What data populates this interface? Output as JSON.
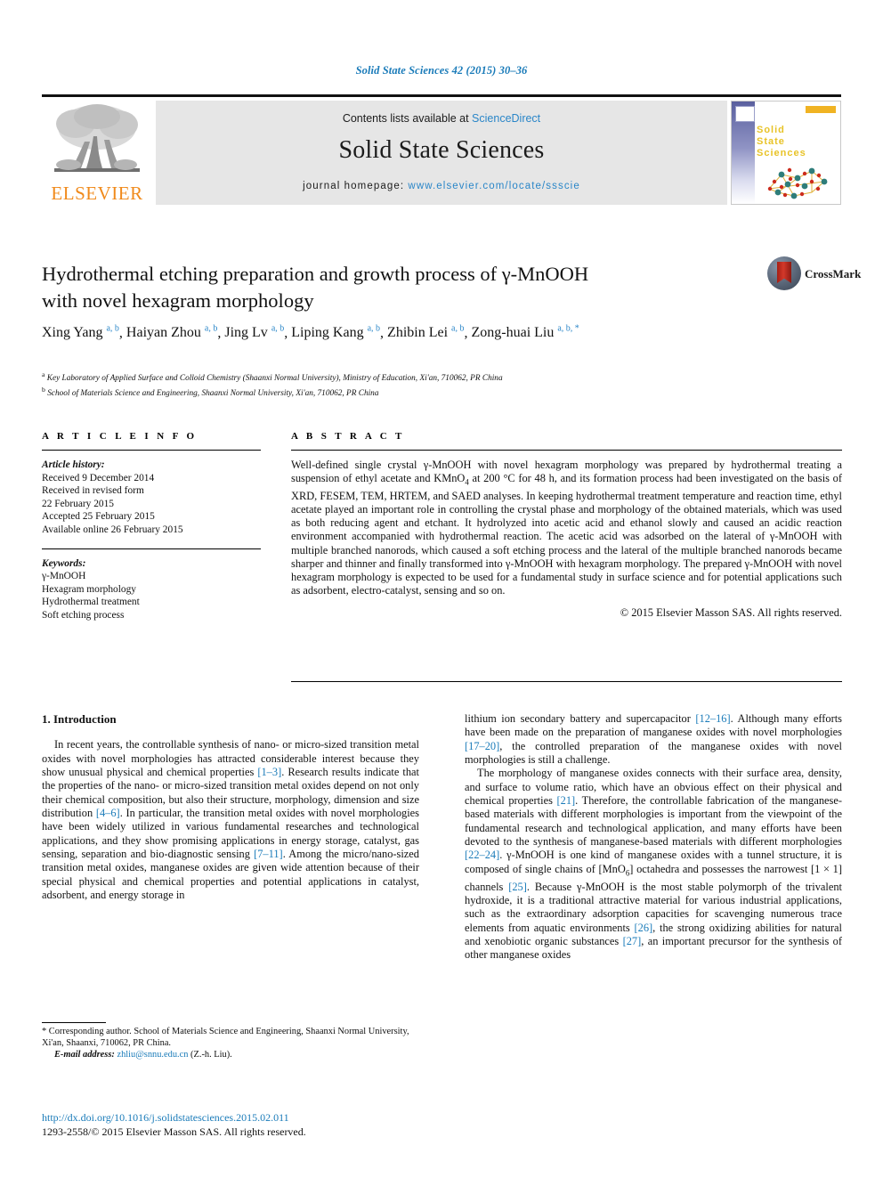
{
  "running_head": "Solid State Sciences 42 (2015) 30–36",
  "masthead": {
    "contents_prefix": "Contents lists available at ",
    "sciencedirect": "ScienceDirect",
    "journal_name": "Solid State Sciences",
    "homepage_label": "journal homepage: ",
    "homepage_url": "www.elsevier.com/locate/ssscie",
    "publisher_logo_text": "ELSEVIER",
    "cover_title": "Solid\nState\nSciences",
    "cover_title_lines": [
      "Solid",
      "State",
      "Sciences"
    ]
  },
  "article": {
    "title_line1": "Hydrothermal etching preparation and growth process of γ-MnOOH",
    "title_line2": "with novel hexagram morphology",
    "crossmark_label": "CrossMark",
    "authors": [
      {
        "name": "Xing Yang",
        "marks": "a, b"
      },
      {
        "name": "Haiyan Zhou",
        "marks": "a, b"
      },
      {
        "name": "Jing Lv",
        "marks": "a, b"
      },
      {
        "name": "Liping Kang",
        "marks": "a, b"
      },
      {
        "name": "Zhibin Lei",
        "marks": "a, b"
      },
      {
        "name": "Zong-huai Liu",
        "marks": "a, b, *"
      }
    ],
    "affiliations": [
      {
        "mark": "a",
        "text": "Key Laboratory of Applied Surface and Colloid Chemistry (Shaanxi Normal University), Ministry of Education, Xi'an, 710062, PR China"
      },
      {
        "mark": "b",
        "text": "School of Materials Science and Engineering, Shaanxi Normal University, Xi'an, 710062, PR China"
      }
    ]
  },
  "info": {
    "heading": "A R T I C L E   I N F O",
    "history_label": "Article history:",
    "history": [
      "Received 9 December 2014",
      "Received in revised form",
      "22 February 2015",
      "Accepted 25 February 2015",
      "Available online 26 February 2015"
    ],
    "keywords_label": "Keywords:",
    "keywords": [
      "γ-MnOOH",
      "Hexagram morphology",
      "Hydrothermal treatment",
      "Soft etching process"
    ]
  },
  "abstract": {
    "heading": "A B S T R A C T",
    "text_part1": "Well-defined single crystal γ-MnOOH with novel hexagram morphology was prepared by hydrothermal treating a suspension of ethyl acetate and KMnO",
    "text_sub": "4",
    "text_part2": " at 200 °C for 48 h, and its formation process had been investigated on the basis of XRD, FESEM, TEM, HRTEM, and SAED analyses. In keeping hydrothermal treatment temperature and reaction time, ethyl acetate played an important role in controlling the crystal phase and morphology of the obtained materials, which was used as both reducing agent and etchant. It hydrolyzed into acetic acid and ethanol slowly and caused an acidic reaction environment accompanied with hydrothermal reaction. The acetic acid was adsorbed on the lateral of γ-MnOOH with multiple branched nanorods, which caused a soft etching process and the lateral of the multiple branched nanorods became sharper and thinner and finally transformed into γ-MnOOH with hexagram morphology. The prepared γ-MnOOH with novel hexagram morphology is expected to be used for a fundamental study in surface science and for potential applications such as adsorbent, electro-catalyst, sensing and so on.",
    "copyright": "© 2015 Elsevier Masson SAS. All rights reserved."
  },
  "body": {
    "section_number_title": "1. Introduction",
    "left_p1_a": "In recent years, the controllable synthesis of nano- or micro-sized transition metal oxides with novel morphologies has attracted considerable interest because they show unusual physical and chemical properties ",
    "left_ref1": "[1–3]",
    "left_p1_b": ". Research results indicate that the properties of the nano- or micro-sized transition metal oxides depend on not only their chemical composition, but also their structure, morphology, dimension and size distribution ",
    "left_ref2": "[4–6]",
    "left_p1_c": ". In particular, the transition metal oxides with novel morphologies have been widely utilized in various fundamental researches and technological applications, and they show promising applications in energy storage, catalyst, gas sensing, separation and bio-diagnostic sensing ",
    "left_ref3": "[7–11]",
    "left_p1_d": ". Among the micro/nano-sized transition metal oxides, manganese oxides are given wide attention because of their special physical and chemical properties and potential applications in catalyst, adsorbent, and energy storage in",
    "right_p1_a": "lithium ion secondary battery and supercapacitor ",
    "right_ref1": "[12–16]",
    "right_p1_b": ". Although many efforts have been made on the preparation of manganese oxides with novel morphologies ",
    "right_ref2": "[17–20]",
    "right_p1_c": ", the controlled preparation of the manganese oxides with novel morphologies is still a challenge.",
    "right_p2_a": "The morphology of manganese oxides connects with their surface area, density, and surface to volume ratio, which have an obvious effect on their physical and chemical properties ",
    "right_ref3": "[21]",
    "right_p2_b": ". Therefore, the controllable fabrication of the manganese-based materials with different morphologies is important from the viewpoint of the fundamental research and technological application, and many efforts have been devoted to the synthesis of manganese-based materials with different morphologies ",
    "right_ref4": "[22–24]",
    "right_p2_c": ". γ-MnOOH is one kind of manganese oxides with a tunnel structure, it is composed of single chains of [MnO",
    "right_sub1": "6",
    "right_p2_d": "] octahedra and possesses the narrowest [1 × 1] channels ",
    "right_ref5": "[25]",
    "right_p2_e": ". Because γ-MnOOH is the most stable polymorph of the trivalent hydroxide, it is a traditional attractive material for various industrial applications, such as the extraordinary adsorption capacities for scavenging numerous trace elements from aquatic environments ",
    "right_ref6": "[26]",
    "right_p2_f": ", the strong oxidizing abilities for natural and xenobiotic organic substances ",
    "right_ref7": "[27]",
    "right_p2_g": ", an important precursor for the synthesis of other manganese oxides"
  },
  "footer": {
    "corresponding_mark": "*",
    "corresponding_text": " Corresponding author. School of Materials Science and Engineering, Shaanxi Normal University, Xi'an, Shaanxi, 710062, PR China.",
    "email_label": "E-mail address:",
    "email": "zhliu@snnu.edu.cn",
    "email_suffix": " (Z.-h. Liu).",
    "doi": "http://dx.doi.org/10.1016/j.solidstatesciences.2015.02.011",
    "issn_line": "1293-2558/© 2015 Elsevier Masson SAS. All rights reserved."
  },
  "colors": {
    "link_blue": "#1a7bb9",
    "sciencedirect_blue": "#2a86c8",
    "elsevier_orange": "#f08a1b",
    "masthead_grey": "#e6e6e6",
    "crossmark_red": "#c0281b"
  }
}
